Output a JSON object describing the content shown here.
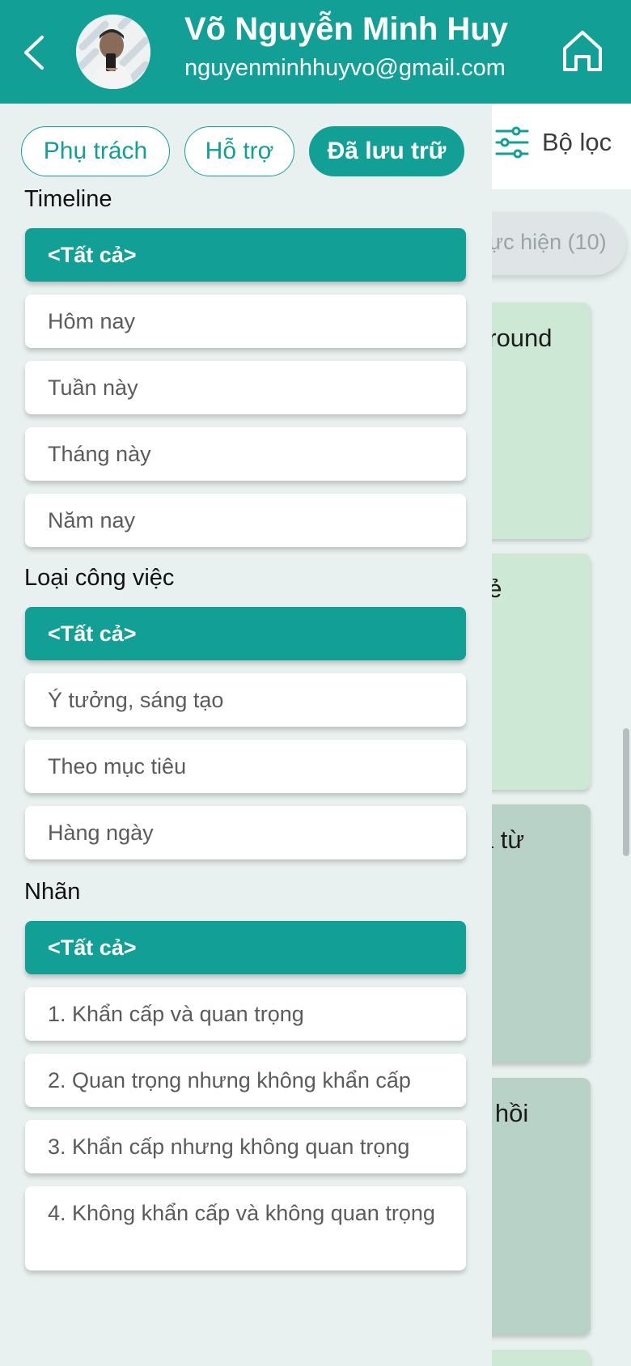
{
  "header": {
    "user_name": "Võ Nguyễn Minh Huy",
    "user_email": "nguyenminhhuyvo@gmail.com",
    "colors": {
      "primary": "#12a096",
      "drawer_bg": "#e8f1ef"
    }
  },
  "tabs": [
    {
      "label": "Phụ trách",
      "active": false
    },
    {
      "label": "Hỗ trợ",
      "active": false
    },
    {
      "label": "Đã lưu trữ",
      "active": true
    }
  ],
  "background": {
    "filter_label": "Bộ lọc",
    "status_pill": "ực hiện (10)",
    "cards": [
      "ground",
      "hẻ",
      "iá từ",
      "n hồi"
    ]
  },
  "filters": {
    "timeline": {
      "title": "Timeline",
      "options": [
        "<Tất cả>",
        "Hôm nay",
        "Tuần này",
        "Tháng này",
        "Năm nay"
      ],
      "selected": "<Tất cả>"
    },
    "task_type": {
      "title": "Loại công việc",
      "options": [
        "<Tất cả>",
        "Ý tưởng, sáng tạo",
        "Theo mục tiêu",
        "Hàng ngày"
      ],
      "selected": "<Tất cả>"
    },
    "labels": {
      "title": "Nhãn",
      "options": [
        "<Tất cả>",
        "1. Khẩn cấp và quan trọng",
        "2. Quan trọng nhưng không khẩn cấp",
        "3. Khẩn cấp nhưng không quan trọng",
        "4. Không khẩn cấp và không quan trọng"
      ],
      "selected": "<Tất cả>"
    }
  },
  "icons": [
    "back-icon",
    "avatar",
    "home-icon",
    "filter-icon"
  ]
}
